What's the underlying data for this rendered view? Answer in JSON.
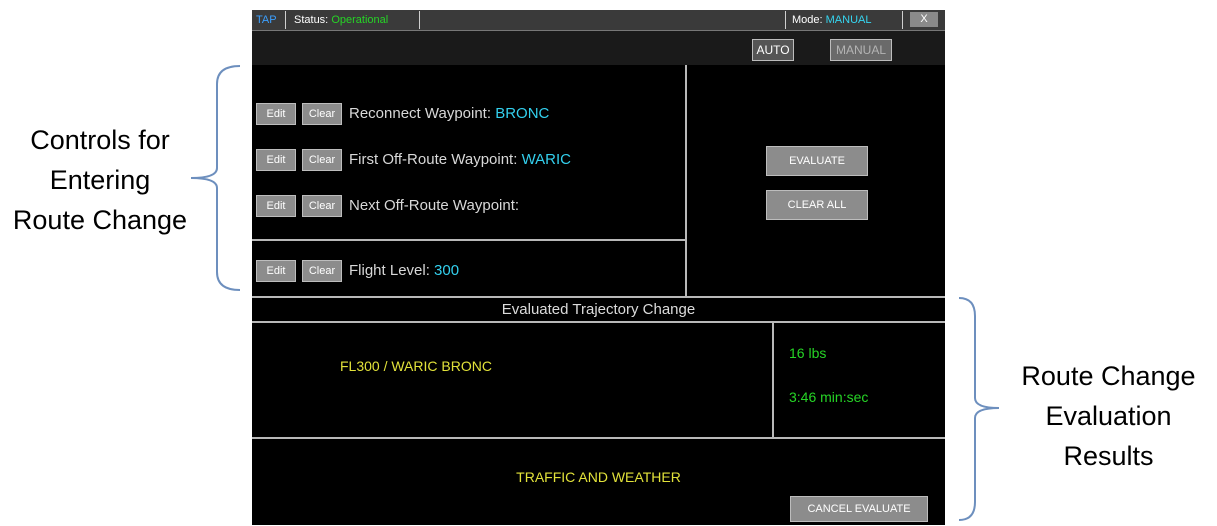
{
  "annotations": {
    "left": [
      "Controls for",
      "Entering",
      "Route Change"
    ],
    "right": [
      "Route Change",
      "Evaluation",
      "Results"
    ]
  },
  "titlebar": {
    "app": "TAP",
    "status_label": "Status:",
    "status_value": "Operational",
    "mode_label": "Mode:",
    "mode_value": "MANUAL",
    "close_label": "X"
  },
  "toolbar": {
    "auto_label": "AUTO",
    "manual_label": "MANUAL"
  },
  "controls": {
    "edit_label": "Edit",
    "clear_label": "Clear",
    "rows": [
      {
        "label": "Reconnect Waypoint:",
        "value": "BRONC"
      },
      {
        "label": "First Off-Route Waypoint:",
        "value": "WARIC"
      },
      {
        "label": "Next Off-Route Waypoint:",
        "value": ""
      },
      {
        "label": "Flight Level:",
        "value": "300"
      }
    ],
    "evaluate_label": "EVALUATE",
    "clear_all_label": "CLEAR ALL"
  },
  "results": {
    "title": "Evaluated Trajectory Change",
    "route": "FL300 / WARIC  BRONC",
    "fuel": "16 lbs",
    "time": "3:46 min:sec",
    "advisory": "TRAFFIC AND WEATHER",
    "cancel_label": "CANCEL EVALUATE"
  },
  "colors": {
    "panel_bg": "#000000",
    "value_cyan": "#33d0ee",
    "status_green": "#26d426",
    "result_yellow": "#e2e23a",
    "button_gray": "#8c8c8c"
  }
}
